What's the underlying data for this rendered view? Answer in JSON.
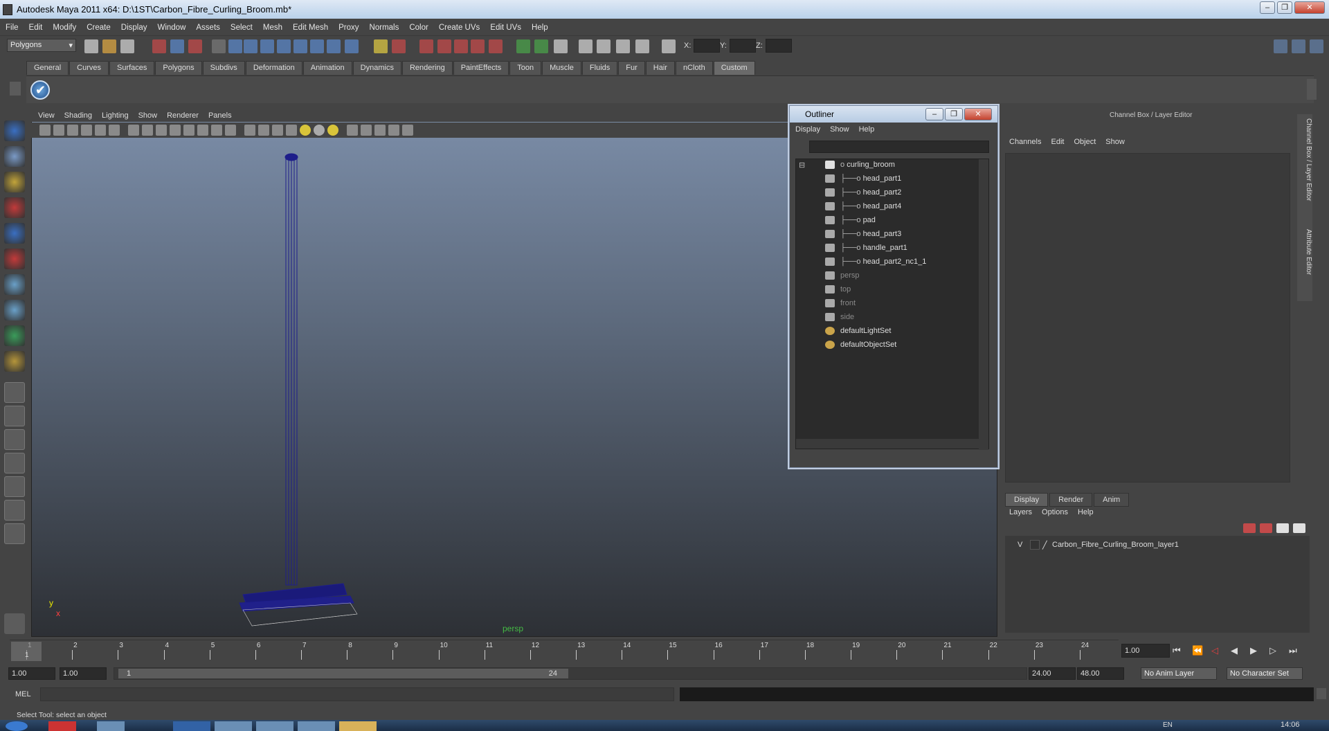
{
  "window": {
    "title": "Autodesk Maya 2011 x64: D:\\1ST\\Carbon_Fibre_Curling_Broom.mb*"
  },
  "menubar": [
    "File",
    "Edit",
    "Modify",
    "Create",
    "Display",
    "Window",
    "Assets",
    "Select",
    "Mesh",
    "Edit Mesh",
    "Proxy",
    "Normals",
    "Color",
    "Create UVs",
    "Edit UVs",
    "Help"
  ],
  "status_line": {
    "mode": "Polygons",
    "x_label": "X:",
    "y_label": "Y:",
    "z_label": "Z:"
  },
  "shelf_tabs": [
    "General",
    "Curves",
    "Surfaces",
    "Polygons",
    "Subdivs",
    "Deformation",
    "Animation",
    "Dynamics",
    "Rendering",
    "PaintEffects",
    "Toon",
    "Muscle",
    "Fluids",
    "Fur",
    "Hair",
    "nCloth",
    "Custom"
  ],
  "shelf_active": "Custom",
  "viewport": {
    "menu": [
      "View",
      "Shading",
      "Lighting",
      "Show",
      "Renderer",
      "Panels"
    ],
    "camera_label": "persp",
    "axis_y": "y",
    "axis_x": "x"
  },
  "outliner": {
    "title": "Outliner",
    "menu": [
      "Display",
      "Show",
      "Help"
    ],
    "items": [
      {
        "label": "curling_broom",
        "level": 0,
        "dim": false
      },
      {
        "label": "head_part1",
        "level": 1,
        "dim": false
      },
      {
        "label": "head_part2",
        "level": 1,
        "dim": false
      },
      {
        "label": "head_part4",
        "level": 1,
        "dim": false
      },
      {
        "label": "pad",
        "level": 1,
        "dim": false
      },
      {
        "label": "head_part3",
        "level": 1,
        "dim": false
      },
      {
        "label": "handle_part1",
        "level": 1,
        "dim": false
      },
      {
        "label": "head_part2_nc1_1",
        "level": 1,
        "dim": false
      },
      {
        "label": "persp",
        "level": 0,
        "dim": true
      },
      {
        "label": "top",
        "level": 0,
        "dim": true
      },
      {
        "label": "front",
        "level": 0,
        "dim": true
      },
      {
        "label": "side",
        "level": 0,
        "dim": true
      },
      {
        "label": "defaultLightSet",
        "level": 0,
        "dim": false
      },
      {
        "label": "defaultObjectSet",
        "level": 0,
        "dim": false
      }
    ]
  },
  "channel_box": {
    "title": "Channel Box / Layer Editor",
    "menu": [
      "Channels",
      "Edit",
      "Object",
      "Show"
    ],
    "side_tabs": [
      "Channel Box / Layer Editor",
      "Attribute Editor"
    ]
  },
  "layer_editor": {
    "tabs": [
      "Display",
      "Render",
      "Anim"
    ],
    "active_tab": "Display",
    "menu": [
      "Layers",
      "Options",
      "Help"
    ],
    "layers": [
      {
        "visibility": "V",
        "name": "Carbon_Fibre_Curling_Broom_layer1"
      }
    ]
  },
  "time_slider": {
    "ticks": [
      "1",
      "2",
      "3",
      "4",
      "5",
      "6",
      "7",
      "8",
      "9",
      "10",
      "11",
      "12",
      "13",
      "14",
      "15",
      "16",
      "17",
      "18",
      "19",
      "20",
      "21",
      "22",
      "23",
      "24"
    ],
    "current_frame": "1",
    "current_time_field": "1.00"
  },
  "range_slider": {
    "start_time": "1.00",
    "playback_start": "1.00",
    "range_start_label": "1",
    "range_end_label": "24",
    "playback_end": "24.00",
    "end_time": "48.00",
    "anim_layer": "No Anim Layer",
    "character_set": "No Character Set"
  },
  "command_line": {
    "label": "MEL"
  },
  "help_line": {
    "text": "Select Tool: select an object"
  },
  "taskbar": {
    "clock": "14:06",
    "lang": "EN"
  }
}
